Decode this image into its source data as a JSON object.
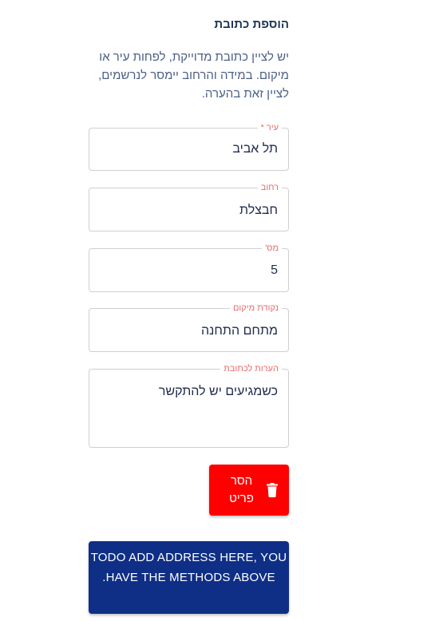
{
  "form": {
    "title": "הוספת כתובת",
    "description": "יש לציין כתובת מדוייקת, לפחות עיר או מיקום. במידה והרחוב יימסר לנרשמים, לציין זאת בהערה.",
    "fields": {
      "city": {
        "label": "עיר *",
        "value": "תל אביב"
      },
      "street": {
        "label": "רחוב",
        "value": "חבצלת"
      },
      "number": {
        "label": "מס'",
        "value": "5"
      },
      "meeting_point": {
        "label": "נקודת מיקום",
        "value": "מתחם התחנה"
      },
      "notes": {
        "label": "הערות לכתובת",
        "value": "כשמגיעים יש להתקשר"
      }
    },
    "remove_button": {
      "label": "הסר פריט",
      "icon": "trash-icon"
    },
    "todo_button": {
      "label": "TODO ADD ADDRESS HERE, YOU HAVE THE METHODS ABOVE."
    }
  },
  "colors": {
    "title": "#1d3557",
    "description": "#4a5f86",
    "label": "#e86a6a",
    "danger": "#ff0000",
    "primary": "#0f2f86"
  }
}
